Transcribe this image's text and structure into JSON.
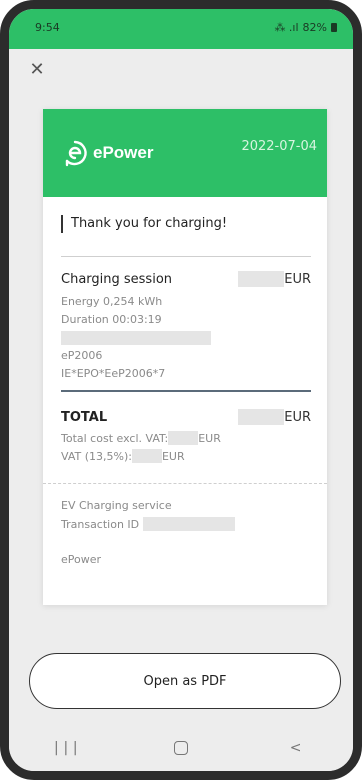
{
  "status_bar": {
    "time": "9:54",
    "signal_text": "⁂ .ıl",
    "battery": "82%"
  },
  "receipt": {
    "logo_text": "ePower",
    "date": "2022-07-04",
    "thanks": "Thank you for charging!",
    "session": {
      "title": "Charging session",
      "currency": "EUR",
      "energy": "Energy 0,254 kWh",
      "duration": "Duration 00:03:19",
      "station": "eP2006",
      "evse_id": "IE*EPO*EeP2006*7"
    },
    "total": {
      "label": "TOTAL",
      "currency": "EUR",
      "excl_vat_label": "Total cost excl. VAT:",
      "excl_vat_currency": "EUR",
      "vat_label": "VAT (13,5%):",
      "vat_currency": "EUR"
    },
    "footer": {
      "service": "EV Charging service",
      "transaction_label": "Transaction ID",
      "company": "ePower"
    }
  },
  "pdf_button": {
    "label": "Open as PDF"
  },
  "colors": {
    "brand": "#2dbf67",
    "frame": "#2c2c2c"
  },
  "icons": {
    "close": "close-icon",
    "recents": "recents-icon",
    "home": "home-icon",
    "back": "back-icon"
  }
}
